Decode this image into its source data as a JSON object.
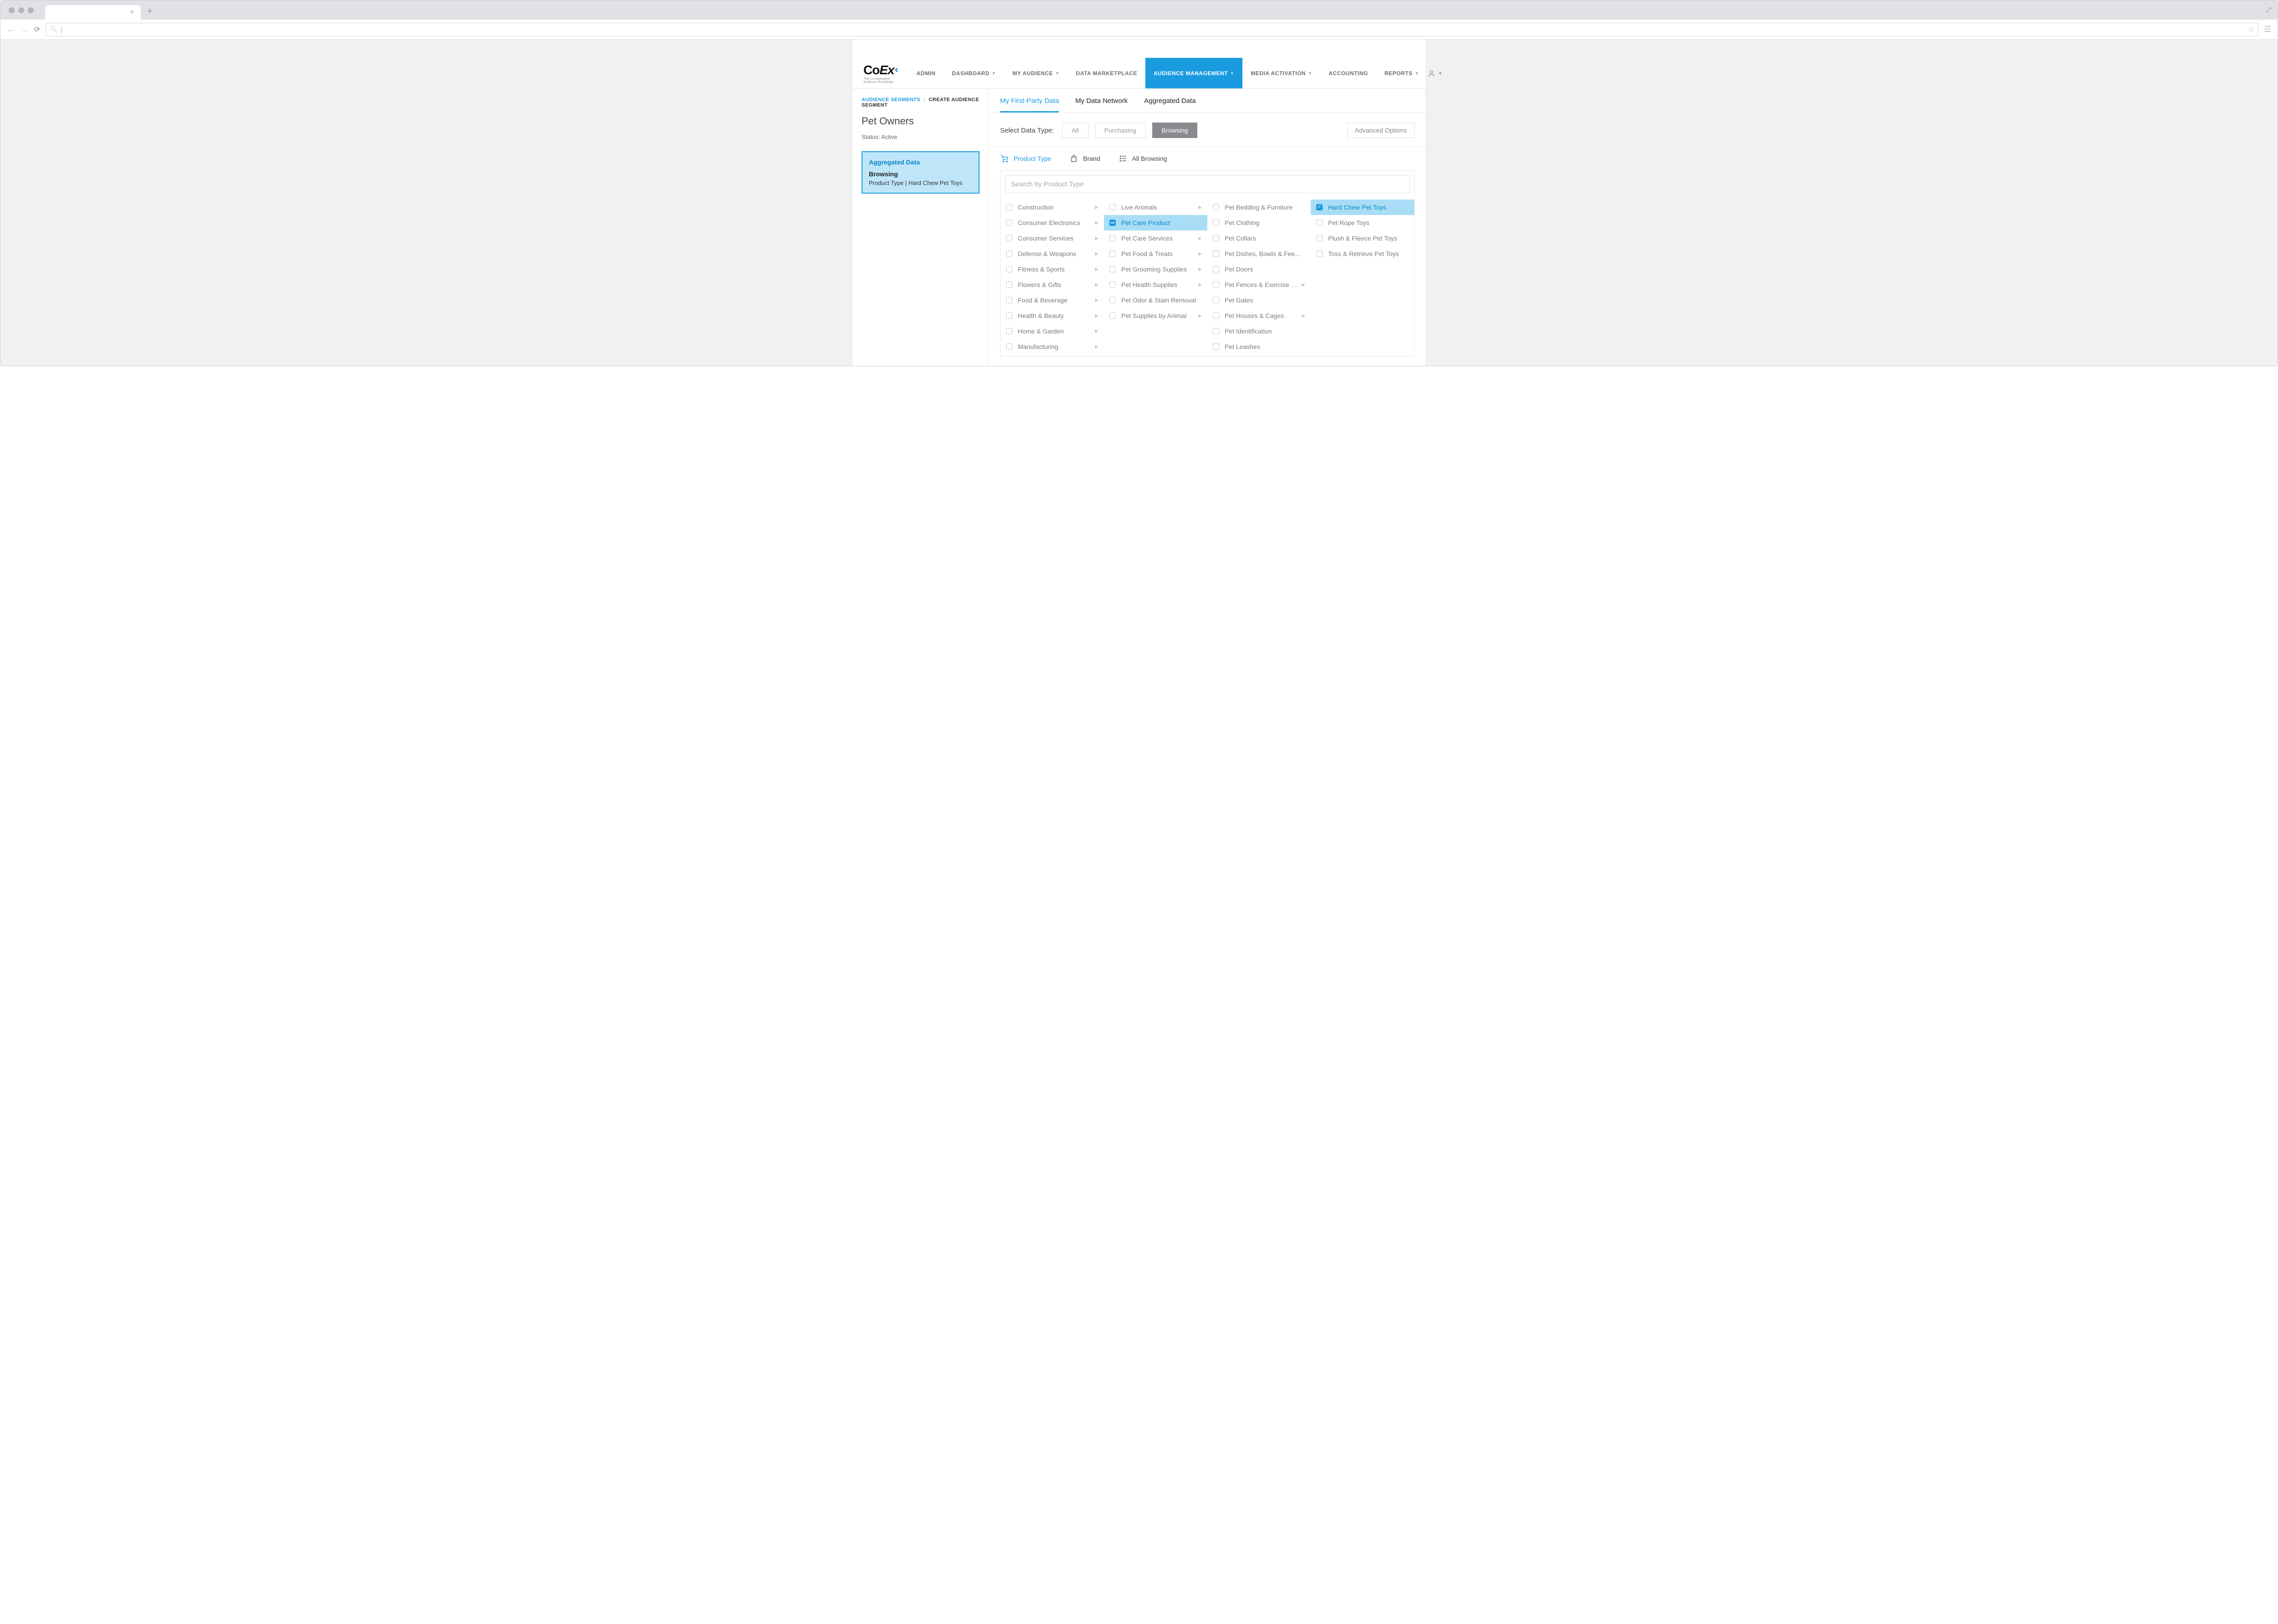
{
  "browser": {
    "tab_close": "×",
    "new_tab": "+"
  },
  "logo": {
    "text_a": "Co",
    "text_b": "Ex",
    "subtitle": "The Co-Operative Audience Exchange"
  },
  "nav": {
    "items": [
      {
        "label": "ADMIN",
        "dropdown": false
      },
      {
        "label": "DASHBOARD",
        "dropdown": true
      },
      {
        "label": "MY AUDIENCE",
        "dropdown": true
      },
      {
        "label": "DATA MARKETPLACE",
        "dropdown": false
      },
      {
        "label": "AUDIENCE MANAGEMENT",
        "dropdown": true,
        "active": true
      },
      {
        "label": "MEDIA ACTIVATION",
        "dropdown": true
      },
      {
        "label": "ACCOUNTING",
        "dropdown": false
      },
      {
        "label": "REPORTS",
        "dropdown": true
      }
    ]
  },
  "breadcrumb": {
    "root": "AUDIENCE SEGMENTS",
    "sep": "/",
    "current": "CREATE AUDIENCE SEGMENT"
  },
  "page": {
    "title": "Pet Owners",
    "status": "Status: Active"
  },
  "segment_card": {
    "title": "Aggregated Data",
    "type": "Browsing",
    "path": "Product Type | Hard Chew Pet Toys"
  },
  "data_tabs": [
    {
      "label": "My First-Party Data",
      "active": true
    },
    {
      "label": "My Data Network"
    },
    {
      "label": "Aggregated Data"
    }
  ],
  "filter": {
    "label": "Select Data Type:",
    "all": "All",
    "purchasing": "Purchasing",
    "browsing": "Browsing",
    "advanced": "Advanced Options"
  },
  "categories": {
    "product_type": "Product Type",
    "brand": "Brand",
    "all_browsing": "All Browsing"
  },
  "search": {
    "placeholder": "Search by Product Type"
  },
  "columns": [
    [
      {
        "label": "Construction",
        "arrow": true
      },
      {
        "label": "Consumer Electronics",
        "arrow": true
      },
      {
        "label": "Consumer Services",
        "arrow": true
      },
      {
        "label": "Defense & Weapons",
        "arrow": true
      },
      {
        "label": "Fitness & Sports",
        "arrow": true
      },
      {
        "label": "Flowers & Gifts",
        "arrow": true
      },
      {
        "label": "Food & Beverage",
        "arrow": true
      },
      {
        "label": "Health & Beauty",
        "arrow": true
      },
      {
        "label": "Home & Garden",
        "arrow": true
      },
      {
        "label": "Manufacturing",
        "arrow": true
      }
    ],
    [
      {
        "label": "Live Animals",
        "arrow": true
      },
      {
        "label": "Pet Care Product",
        "arrow": true,
        "path_selected": true
      },
      {
        "label": "Pet Care Services",
        "arrow": true
      },
      {
        "label": "Pet Food & Treats",
        "arrow": true
      },
      {
        "label": "Pet Grooming Supplies",
        "arrow": true
      },
      {
        "label": "Pet Health Supplies",
        "arrow": true
      },
      {
        "label": "Pet Odor & Stain Removal"
      },
      {
        "label": "Pet Supplies by Animal",
        "arrow": true
      }
    ],
    [
      {
        "label": "Pet Bedding & Furniture"
      },
      {
        "label": "Pet Clothing"
      },
      {
        "label": "Pet Collars"
      },
      {
        "label": "Pet Dishes, Bowls & Fee…"
      },
      {
        "label": "Pet Doors"
      },
      {
        "label": "Pet Fences & Exercise P…",
        "arrow": true
      },
      {
        "label": "Pet Gates"
      },
      {
        "label": "Pet Houses & Cages",
        "arrow": true
      },
      {
        "label": "Pet Identification"
      },
      {
        "label": "Pet Leashes"
      }
    ],
    [
      {
        "label": "Hard Chew Pet Toys",
        "checked": true
      },
      {
        "label": "Pet Rope Toys"
      },
      {
        "label": "Plush & Fleece Pet Toys"
      },
      {
        "label": "Toss & Retrieve Pet Toys"
      }
    ]
  ]
}
